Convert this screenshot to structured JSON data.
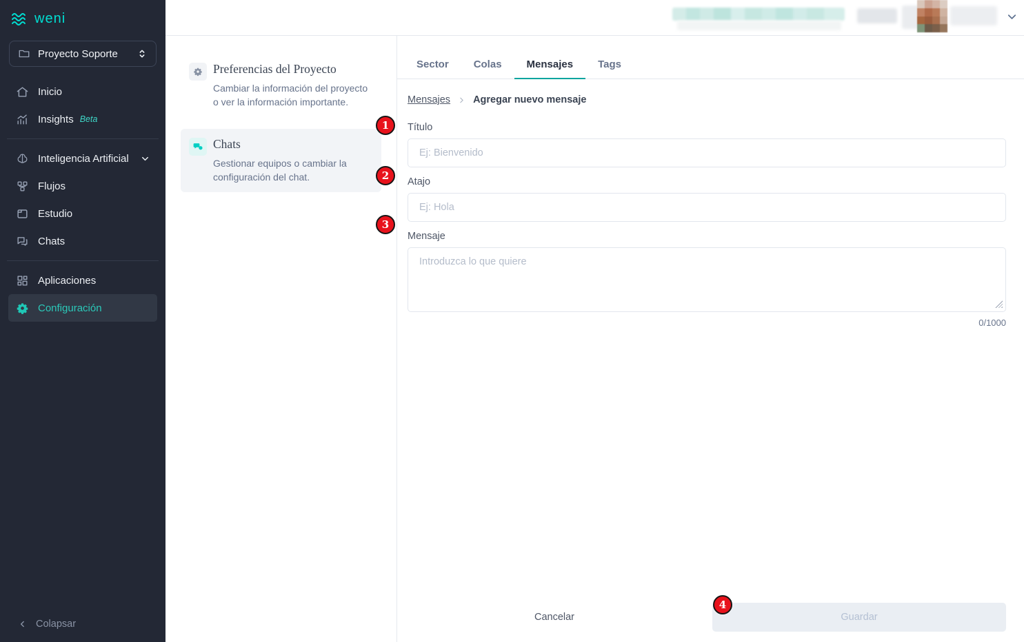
{
  "colors": {
    "accent_teal": "#00DED2",
    "tab_underline_teal": "#00A49F",
    "annotation_red": "#E8121C",
    "sidebar_bg": "#232835",
    "selected_item_bg": "#313845",
    "disabled_button_bg": "#EAEEF3"
  },
  "sidebar": {
    "logo_text": "weni",
    "logo_icon": "waves-icon",
    "project_selector": {
      "label": "Proyecto Soporte",
      "left_icon": "folder-icon",
      "right_icon": "unfold-more-icon"
    },
    "items": [
      {
        "label": "Inicio",
        "icon": "home-icon"
      },
      {
        "label": "Insights",
        "icon": "insights-icon",
        "badge": "Beta"
      },
      {
        "label": "Inteligencia Artificial",
        "icon": "brain-icon",
        "right_icon": "chevron-down-icon"
      },
      {
        "label": "Flujos",
        "icon": "flows-icon"
      },
      {
        "label": "Estudio",
        "icon": "studio-icon"
      },
      {
        "label": "Chats",
        "icon": "chats-icon"
      },
      {
        "label": "Aplicaciones",
        "icon": "apps-icon"
      },
      {
        "label": "Configuración",
        "icon": "gear-icon",
        "selected": true
      }
    ],
    "collapse": {
      "label": "Colapsar",
      "icon": "chevron-left-icon"
    }
  },
  "header": {
    "right_icon": "chevron-down-icon",
    "blurred_items": [
      "trial-badge-blurred",
      "account-info-blurred",
      "user-avatar-pixelated"
    ]
  },
  "settings_nav": {
    "items": [
      {
        "title": "Preferencias del Proyecto",
        "description": "Cambiar la información del proyecto o ver la información importante.",
        "icon": "gear-icon"
      },
      {
        "title": "Chats",
        "description": "Gestionar equipos o cambiar la configuración del chat.",
        "icon": "chat-bubbles-icon",
        "selected": true
      }
    ]
  },
  "main": {
    "tabs": [
      {
        "label": "Sector"
      },
      {
        "label": "Colas"
      },
      {
        "label": "Mensajes",
        "active": true
      },
      {
        "label": "Tags"
      }
    ],
    "breadcrumb": {
      "parent": "Mensajes",
      "separator_icon": "chevron-right-icon",
      "current": "Agregar nuevo mensaje"
    },
    "form": {
      "title_label": "Título",
      "title_placeholder": "Ej: Bienvenido",
      "title_value": "",
      "shortcut_label": "Atajo",
      "shortcut_placeholder": "Ej: Hola",
      "shortcut_value": "",
      "message_label": "Mensaje",
      "message_placeholder": "Introduzca lo que quiere",
      "message_value": "",
      "char_counter": "0/1000"
    },
    "footer": {
      "cancel_label": "Cancelar",
      "save_label": "Guardar",
      "save_disabled": true
    }
  },
  "annotations": {
    "markers": [
      "1",
      "2",
      "3",
      "4"
    ]
  }
}
